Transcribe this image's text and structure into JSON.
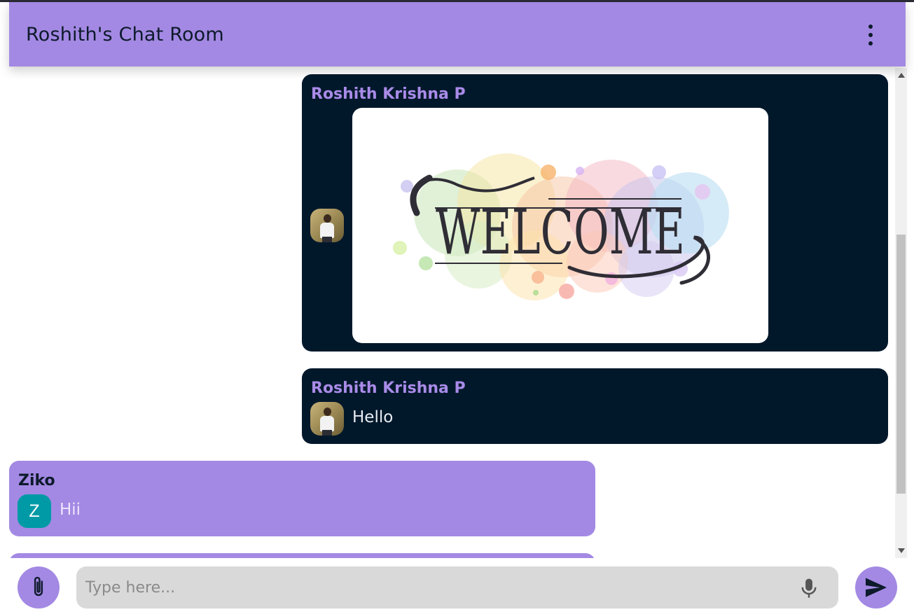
{
  "header": {
    "title": "Roshith's Chat Room",
    "menu_icon": "more-vertical-icon"
  },
  "colors": {
    "accent": "#a389e3",
    "dark_bubble": "#01182b",
    "avatar_teal": "#009aa6",
    "input_bg": "#d9d9d9"
  },
  "messages": [
    {
      "sender": "Roshith Krishna P",
      "type": "image",
      "avatar": "profile-photo",
      "image_text": "WELCOME"
    },
    {
      "sender": "Roshith Krishna P",
      "type": "text",
      "avatar": "profile-photo",
      "text": "Hello"
    },
    {
      "sender": "Ziko",
      "type": "text",
      "avatar_letter": "Z",
      "text": "Hii"
    }
  ],
  "composer": {
    "placeholder": "Type here...",
    "attach_icon": "paperclip-icon",
    "mic_icon": "microphone-icon",
    "send_icon": "send-icon"
  }
}
